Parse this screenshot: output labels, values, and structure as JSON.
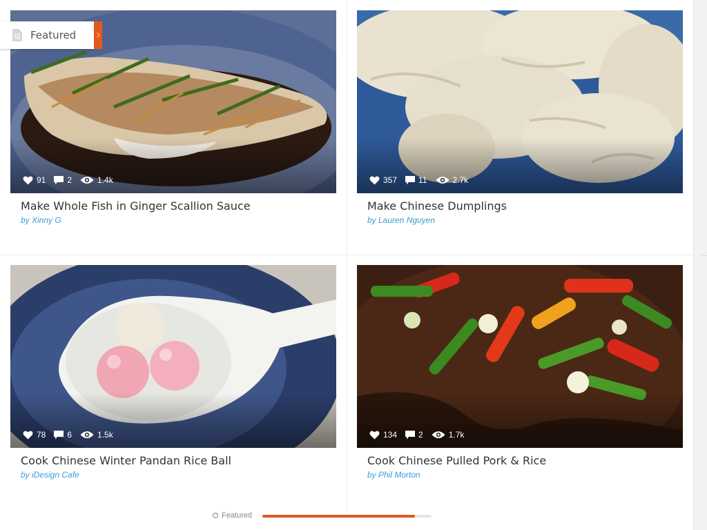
{
  "featured_tab": {
    "label": "Featured"
  },
  "cards": [
    {
      "title": "Make Whole Fish in Ginger Scallion Sauce",
      "author": "by Xinny G",
      "likes": "91",
      "comments": "2",
      "views": "1.4k",
      "image": "steamed-fish-photo"
    },
    {
      "title": "Make Chinese Dumplings",
      "author": "by Lauren Nguyen",
      "likes": "357",
      "comments": "11",
      "views": "2.7k",
      "image": "dumplings-photo"
    },
    {
      "title": "Cook Chinese Winter Pandan Rice Ball",
      "author": "by iDesign Cafe",
      "likes": "78",
      "comments": "6",
      "views": "1.5k",
      "image": "rice-ball-spoon-photo"
    },
    {
      "title": "Cook Chinese Pulled Pork & Rice",
      "author": "by Phil Morton",
      "likes": "134",
      "comments": "2",
      "views": "1.7k",
      "image": "pulled-pork-photo"
    }
  ],
  "footer": {
    "label": "Featured",
    "progress": 0.9
  },
  "colors": {
    "accent": "#e05a1c",
    "author_link": "#3f9ad6",
    "title_text": "#333333"
  }
}
